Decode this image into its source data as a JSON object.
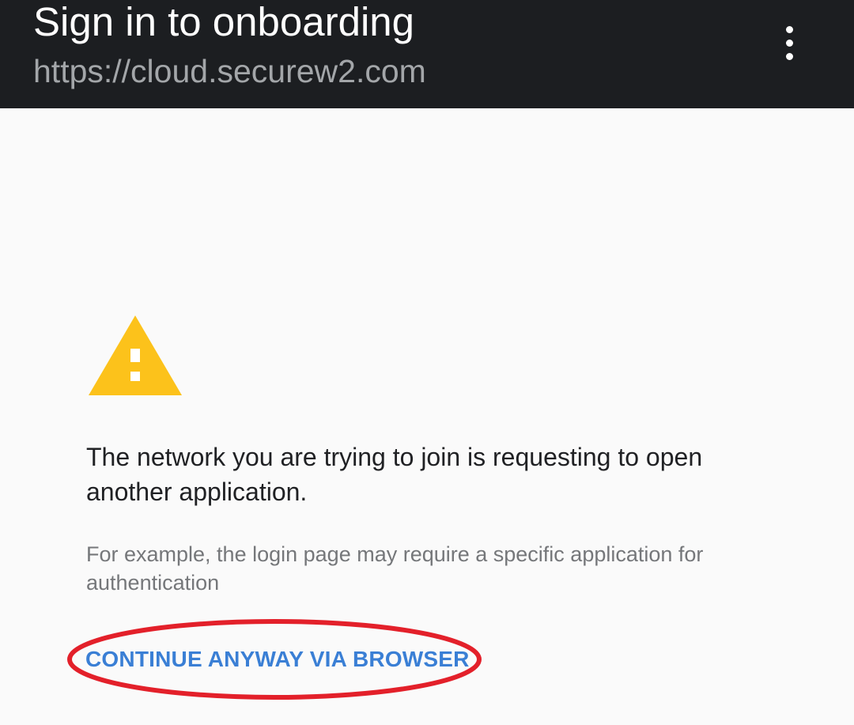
{
  "header": {
    "title": "Sign in to onboarding",
    "url": "https://cloud.securew2.com",
    "menu_icon": "more-vert-icon"
  },
  "content": {
    "warning_icon": "warning-icon",
    "message": "The network you are trying to join is requesting to open another application.",
    "detail": "For example, the login page may require a specific application for authentication",
    "action_label": "CONTINUE ANYWAY VIA BROWSER"
  },
  "colors": {
    "header_bg": "#1c1e21",
    "warning": "#fcc21b",
    "link": "#3a7fd5",
    "highlight_ellipse": "#e3202a"
  }
}
